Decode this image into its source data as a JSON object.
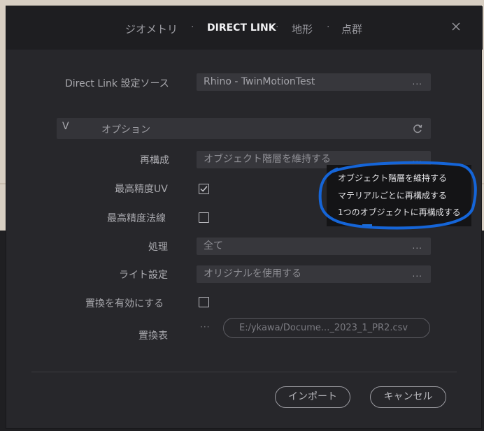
{
  "colors": {
    "accent_annotation": "#1565d8",
    "dialog_bg": "#27272b",
    "header_bg": "#1e1e21",
    "field_bg": "#37373c",
    "dropdown_bg": "#141416"
  },
  "header": {
    "tabs": [
      {
        "label": "ジオメトリ",
        "active": false
      },
      {
        "label": "DIRECT LINK",
        "active": true
      },
      {
        "label": "地形",
        "active": false
      },
      {
        "label": "点群",
        "active": false
      }
    ],
    "separator": "·",
    "close_icon": "close-icon"
  },
  "source": {
    "label": "Direct Link 設定ソース",
    "value": "Rhino - TwinMotionTest",
    "dots": "..."
  },
  "options": {
    "section_title": "オプション",
    "chevron": "V",
    "refresh_icon": "refresh-icon",
    "rebuild": {
      "label": "再構成",
      "value": "オブジェクト階層を維持する",
      "dots": "..."
    },
    "max_uv": {
      "label": "最高精度UV",
      "checked": true
    },
    "max_normal": {
      "label": "最高精度法線",
      "checked": false
    },
    "processing": {
      "label": "処理",
      "value": "全て",
      "dots": "..."
    },
    "light": {
      "label": "ライト設定",
      "value": "オリジナルを使用する",
      "dots": "..."
    },
    "replace_enable": {
      "label": "置換を有効にする",
      "checked": false
    },
    "replace_table": {
      "label": "置換表",
      "dots": "···",
      "value": "E:/ykawa/Docume..._2023_1_PR2.csv"
    }
  },
  "dropdown": {
    "dots": "...",
    "items": [
      "オブジェクト階層を維持する",
      "マテリアルごとに再構成する",
      "1つのオブジェクトに再構成する"
    ]
  },
  "buttons": {
    "import": "インポート",
    "cancel": "キャンセル"
  }
}
